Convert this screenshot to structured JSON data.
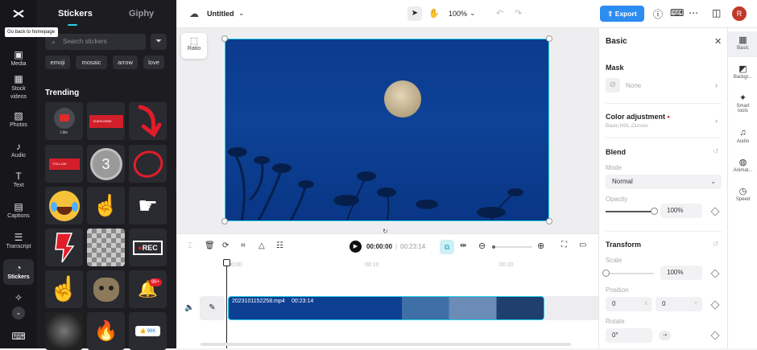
{
  "app": {
    "project_title": "Untitled",
    "zoom": "100%",
    "export_label": "Export",
    "avatar_letter": "R",
    "brand_color": "#2d8cf0"
  },
  "tooltip": "Go back to homepage",
  "left_rail": {
    "items": [
      {
        "label": "Media",
        "icon": "media-icon"
      },
      {
        "label": "Stock videos",
        "icon": "film-icon"
      },
      {
        "label": "Photos",
        "icon": "image-icon"
      },
      {
        "label": "Audio",
        "icon": "music-icon"
      },
      {
        "label": "Text",
        "icon": "text-icon"
      },
      {
        "label": "Captions",
        "icon": "captions-icon"
      },
      {
        "label": "Transcript",
        "icon": "transcript-icon"
      },
      {
        "label": "Stickers",
        "icon": "sticker-icon"
      }
    ]
  },
  "panel": {
    "tabs": [
      "Stickers",
      "Giphy"
    ],
    "search_placeholder": "Search stickers",
    "chips": [
      "emoji",
      "mosaic",
      "arrow",
      "love"
    ],
    "section_title": "Trending",
    "sticker_texts": {
      "like": "Like",
      "subscribe": "SUBSCRIBE",
      "follow": "FOLLOW",
      "countdown": "3",
      "rec": "REC",
      "badge": "99+",
      "likes": "99K"
    }
  },
  "canvas": {
    "ratio_label": "Ratio"
  },
  "player": {
    "current_time": "00:00:00",
    "total_time": "00:23:14"
  },
  "timeline": {
    "ticks": [
      "00:00",
      "00:10",
      "00:20"
    ],
    "clip_name": "2023101152258.mp4",
    "clip_duration": "00:23:14"
  },
  "right_panel": {
    "title": "Basic",
    "mask_title": "Mask",
    "mask_value": "None",
    "color_adjust_title": "Color adjustment",
    "color_adjust_sub": "Basic,HSL,Curves",
    "blend_title": "Blend",
    "mode_label": "Mode",
    "mode_value": "Normal",
    "opacity_label": "Opacity",
    "opacity_value": "100%",
    "opacity_level": 1.0,
    "transform_title": "Transform",
    "scale_label": "Scale",
    "scale_value": "100%",
    "scale_level": 0.0,
    "position_label": "Position",
    "pos_x": "0",
    "pos_x_label": "X",
    "pos_y": "0",
    "pos_y_label": "Y",
    "rotate_label": "Rotate",
    "rotate_value": "0°"
  },
  "right_rail": {
    "items": [
      "Basic",
      "Backgr...",
      "Smart tools",
      "Audio",
      "Animat...",
      "Speed"
    ]
  }
}
